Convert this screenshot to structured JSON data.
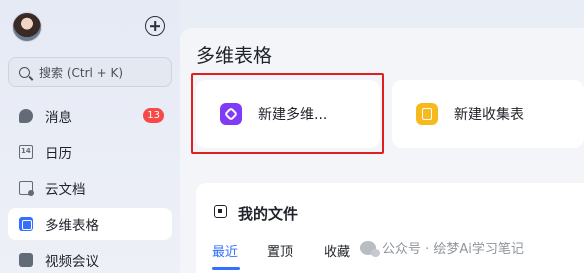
{
  "sidebar": {
    "search_label": "搜索 (Ctrl + K)",
    "items": [
      {
        "label": "消息",
        "icon": "message-icon",
        "badge": "13"
      },
      {
        "label": "日历",
        "icon": "calendar-icon"
      },
      {
        "label": "云文档",
        "icon": "document-icon"
      },
      {
        "label": "多维表格",
        "icon": "base-icon",
        "active": true
      },
      {
        "label": "视频会议",
        "icon": "video-icon"
      }
    ]
  },
  "main": {
    "title": "多维表格",
    "cards": [
      {
        "label": "新建多维...",
        "icon": "new-base-icon",
        "icon_color": "#7f3bf5"
      },
      {
        "label": "新建收集表",
        "icon": "form-icon",
        "icon_color": "#f7ba1e"
      }
    ],
    "files": {
      "title": "我的文件",
      "tabs": [
        {
          "label": "最近",
          "active": true
        },
        {
          "label": "置顶"
        },
        {
          "label": "收藏"
        }
      ]
    },
    "watermark": "公众号 · 绘梦Ai学习笔记"
  },
  "colors": {
    "accent": "#3370ff",
    "badge": "#f54a45",
    "highlight_box": "#e02020"
  }
}
